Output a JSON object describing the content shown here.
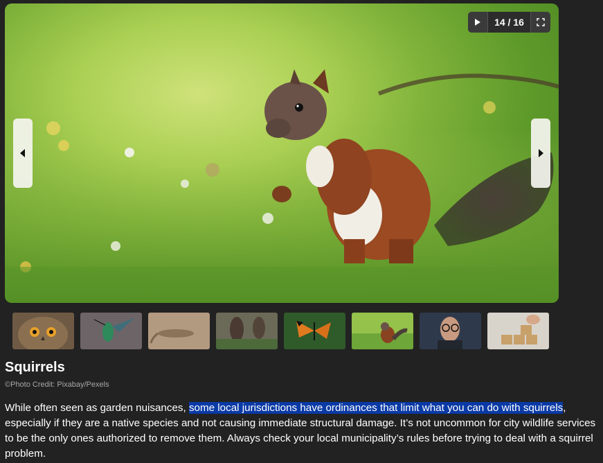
{
  "slideshow": {
    "counter": "14 / 16",
    "play_icon": "play-icon",
    "fullscreen_icon": "fullscreen-icon",
    "prev_icon": "arrow-left-icon",
    "next_icon": "arrow-right-icon"
  },
  "thumbnails": [
    {
      "subject": "owl"
    },
    {
      "subject": "hummingbird"
    },
    {
      "subject": "lizard"
    },
    {
      "subject": "bats"
    },
    {
      "subject": "butterfly"
    },
    {
      "subject": "squirrel"
    },
    {
      "subject": "man with glasses"
    },
    {
      "subject": "blocks"
    }
  ],
  "caption": {
    "title": "Squirrels",
    "credit": "©Photo Credit: Pixabay/Pexels",
    "text_before": "While often seen as garden nuisances, ",
    "text_highlight": "some local jurisdictions have ordinances that limit what you can do with squirrels",
    "text_after": ", especially if they are a native species and not causing immediate structural damage. It’s not uncommon for city wildlife services to be the only ones authorized to remove them. Always check your local municipality’s rules before trying to deal with a squirrel problem."
  },
  "colors": {
    "background": "#222222",
    "highlight": "#0a3aa6"
  }
}
